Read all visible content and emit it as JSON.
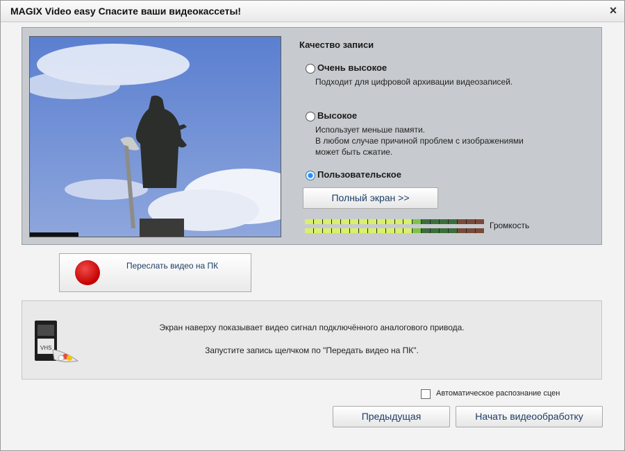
{
  "window": {
    "title": "MAGIX Video easy Спасите ваши видеокассеты!",
    "close_symbol": "×"
  },
  "quality": {
    "title": "Качество записи",
    "options": [
      {
        "label": "Очень высокое",
        "desc": [
          "Подходит для цифровой архивации видеозаписей."
        ],
        "selected": false
      },
      {
        "label": "Высокое",
        "desc": [
          "Использует меньше памяти.",
          "В любом случае причиной проблем с изображениями",
          "может быть сжатие."
        ],
        "selected": false
      },
      {
        "label": "Пользовательское",
        "desc": [],
        "selected": true
      }
    ]
  },
  "fullscreen_button": "Полный экран >>",
  "volume": {
    "label": "Громкость",
    "level_fraction": 0.66
  },
  "send_button": "Переслать видео на ПК",
  "info": {
    "line1": "Экран наверху показывает видео сигнал подключённого аналогового привода.",
    "line2": "Запустите запись щелчком по \"Передать видео на ПК\"."
  },
  "auto_scene": {
    "label": "Автоматическое распознание сцен",
    "checked": false
  },
  "prev_button": "Предыдущая",
  "start_button": "Начать видеообработку",
  "colors": {
    "accent": "#1f3d66",
    "record": "#c40000",
    "panel": "#c7cbcf"
  }
}
